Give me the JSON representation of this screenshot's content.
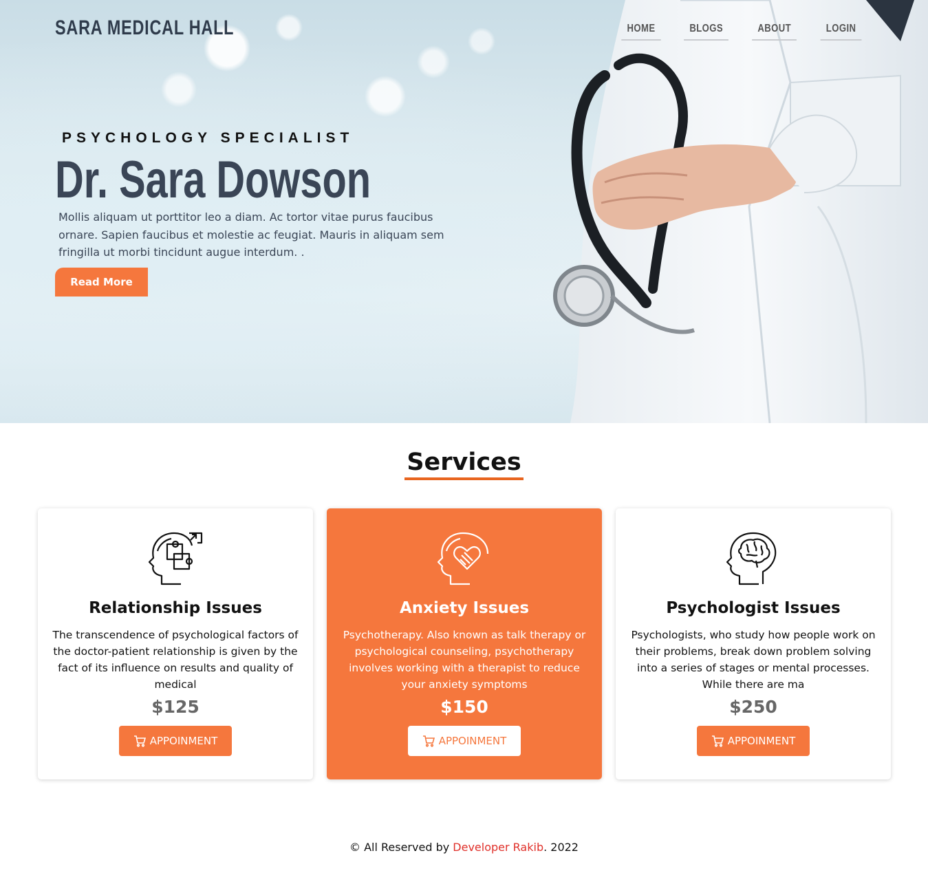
{
  "brand": "SARA MEDICAL HALL",
  "nav": {
    "home": "HOME",
    "blogs": "BLOGS",
    "about": "ABOUT",
    "login": "LOGIN"
  },
  "hero": {
    "subtitle": "PSYCHOLOGY SPECIALIST",
    "title": "Dr. Sara Dowson",
    "text": "Mollis aliquam ut porttitor leo a diam. Ac tortor vitae purus faucibus ornare. Sapien faucibus et molestie ac feugiat. Mauris in aliquam sem fringilla ut morbi tincidunt augue interdum. .",
    "button": "Read More"
  },
  "services": {
    "heading": "Services",
    "accent": "#f5773d",
    "items": [
      {
        "title": "Relationship Issues",
        "description": "The transcendence of psychological factors of the doctor-patient relationship is given by the fact of its influence on results and quality of medical",
        "price": "$125",
        "button": "APPOINMENT",
        "icon": "head-puzzle-icon"
      },
      {
        "title": "Anxiety Issues",
        "description": "Psychotherapy. Also known as talk therapy or psychological counseling, psychotherapy involves working with a therapist to reduce your anxiety symptoms",
        "price": "$150",
        "button": "APPOINMENT",
        "icon": "head-heart-icon"
      },
      {
        "title": "Psychologist Issues",
        "description": "Psychologists, who study how people work on their problems, break down problem solving into a series of stages or mental processes. While there are ma",
        "price": "$250",
        "button": "APPOINMENT",
        "icon": "head-brain-icon"
      }
    ]
  },
  "footer": {
    "prefix": "© All Reserved by ",
    "developer": "Developer Rakib",
    "suffix": ". 2022"
  }
}
